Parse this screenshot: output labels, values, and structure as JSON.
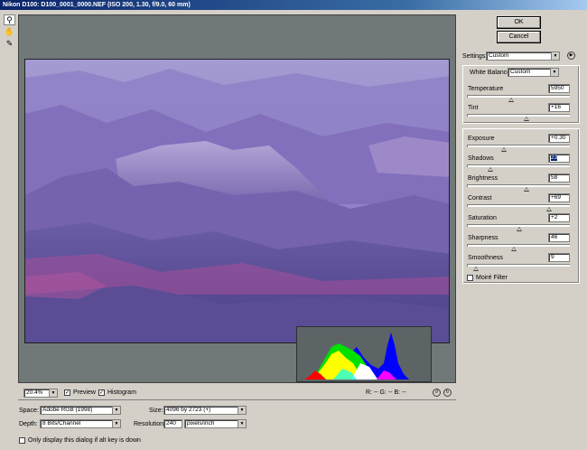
{
  "window": {
    "title": "Nikon D100: D100_0001_0000.NEF  (ISO 200, 1.30, f/9.0, 60 mm)"
  },
  "tools": [
    {
      "name": "zoom-tool-icon",
      "glyph": "🔍",
      "active": true
    },
    {
      "name": "hand-tool-icon",
      "glyph": "✋",
      "active": false
    },
    {
      "name": "eyedropper-tool-icon",
      "glyph": "✎",
      "active": false
    }
  ],
  "buttons": {
    "ok_label": "OK",
    "cancel_label": "Cancel"
  },
  "settings": {
    "label": "Settings:",
    "value": "Custom"
  },
  "white_balance": {
    "label": "White Balance:",
    "value": "Custom"
  },
  "adjustments": [
    {
      "id": "temperature",
      "label": "Temperature",
      "value": "5950",
      "level": 0.43,
      "selected": false
    },
    {
      "id": "tint",
      "label": "Tint",
      "value": "+16",
      "level": 0.58,
      "selected": false
    },
    {
      "id": "exposure",
      "label": "Exposure",
      "value": "+0.30",
      "level": 0.36,
      "selected": false
    },
    {
      "id": "shadows",
      "label": "Shadows",
      "value": "23",
      "level": 0.23,
      "selected": true
    },
    {
      "id": "brightness",
      "label": "Brightness",
      "value": "58",
      "level": 0.58,
      "selected": false
    },
    {
      "id": "contrast",
      "label": "Contrast",
      "value": "+69",
      "level": 0.8,
      "selected": false
    },
    {
      "id": "saturation",
      "label": "Saturation",
      "value": "+2",
      "level": 0.51,
      "selected": false
    },
    {
      "id": "sharpness",
      "label": "Sharpness",
      "value": "46",
      "level": 0.46,
      "selected": false
    },
    {
      "id": "smoothness",
      "label": "Smoothness",
      "value": "9",
      "level": 0.09,
      "selected": false
    }
  ],
  "moire": {
    "label": "Moiré Filter",
    "checked": false
  },
  "view": {
    "zoom": "20.4%",
    "preview_label": "Preview",
    "preview_checked": true,
    "histogram_label": "Histogram",
    "histogram_checked": true,
    "rgb_readout": "R:  --  G:  --  B:  --"
  },
  "output": {
    "space_label": "Space:",
    "space_value": "Adobe RGB (1998)",
    "depth_label": "Depth:",
    "depth_value": "8 Bits/Channel",
    "size_label": "Size:",
    "size_value": "4096 by 2723  (+)",
    "resolution_label": "Resolution:",
    "resolution_value": "240",
    "resolution_unit": "pixels/inch"
  },
  "footer": {
    "alt_key_label": "Only display this dialog if alt key is down",
    "alt_key_checked": false
  },
  "colors": {
    "dialog_bg": "#d4d0c8",
    "title_blue": "#0a246a",
    "preview_bg": "#707878"
  }
}
